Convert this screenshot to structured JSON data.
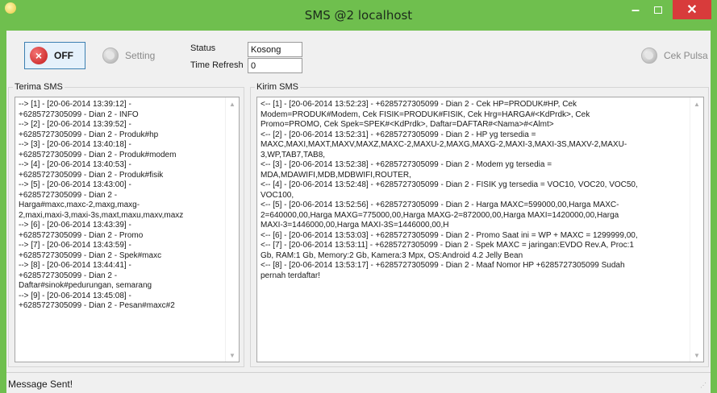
{
  "window": {
    "title": "SMS @2 localhost"
  },
  "toolbar": {
    "off_label": "OFF",
    "setting_label": "Setting",
    "cek_pulsa_label": "Cek Pulsa"
  },
  "fields": {
    "status_label": "Status",
    "status_value": "Kosong",
    "time_refresh_label": "Time Refresh",
    "time_refresh_value": "0"
  },
  "terima": {
    "title": "Terima SMS",
    "lines": [
      "--> [1] - [20-06-2014 13:39:12] -",
      "+6285727305099 - Dian 2 - INFO",
      "--> [2] - [20-06-2014 13:39:52] -",
      "+6285727305099 - Dian 2 - Produk#hp",
      "--> [3] - [20-06-2014 13:40:18] -",
      "+6285727305099 - Dian 2 - Produk#modem",
      "--> [4] - [20-06-2014 13:40:53] -",
      "+6285727305099 - Dian 2 - Produk#fisik",
      "--> [5] - [20-06-2014 13:43:00] -",
      "+6285727305099 - Dian 2 -",
      "Harga#maxc,maxc-2,maxg,maxg-",
      "2,maxi,maxi-3,maxi-3s,maxt,maxu,maxv,maxz",
      "--> [6] - [20-06-2014 13:43:39] -",
      "+6285727305099 - Dian 2 - Promo",
      "--> [7] - [20-06-2014 13:43:59] -",
      "+6285727305099 - Dian 2 - Spek#maxc",
      "--> [8] - [20-06-2014 13:44:41] -",
      "+6285727305099 - Dian 2 -",
      "Daftar#sinok#pedurungan, semarang",
      "--> [9] - [20-06-2014 13:45:08] -",
      "+6285727305099 - Dian 2 - Pesan#maxc#2"
    ]
  },
  "kirim": {
    "title": "Kirim SMS",
    "lines": [
      "<-- [1] - [20-06-2014 13:52:23] - +6285727305099 - Dian 2 - Cek HP=PRODUK#HP, Cek",
      "Modem=PRODUK#Modem, Cek FISIK=PRODUK#FISIK, Cek Hrg=HARGA#<KdPrdk>, Cek",
      "Promo=PROMO, Cek Spek=SPEK#<KdPrdk>, Daftar=DAFTAR#<Nama>#<Almt>",
      "<-- [2] - [20-06-2014 13:52:31] - +6285727305099 - Dian 2 - HP yg tersedia =",
      "MAXC,MAXI,MAXT,MAXV,MAXZ,MAXC-2,MAXU-2,MAXG,MAXG-2,MAXI-3,MAXI-3S,MAXV-2,MAXU-",
      "3,WP,TAB7,TAB8,",
      "<-- [3] - [20-06-2014 13:52:38] - +6285727305099 - Dian 2 - Modem yg tersedia =",
      "MDA,MDAWIFI,MDB,MDBWIFI,ROUTER,",
      "<-- [4] - [20-06-2014 13:52:48] - +6285727305099 - Dian 2 - FISIK yg tersedia = VOC10, VOC20, VOC50,",
      "VOC100,",
      "<-- [5] - [20-06-2014 13:52:56] - +6285727305099 - Dian 2 - Harga MAXC=599000,00,Harga MAXC-",
      "2=640000,00,Harga MAXG=775000,00,Harga MAXG-2=872000,00,Harga MAXI=1420000,00,Harga",
      "MAXI-3=1446000,00,Harga MAXI-3S=1446000,00,H",
      "<-- [6] - [20-06-2014 13:53:03] - +6285727305099 - Dian 2 - Promo Saat ini = WP + MAXC = 1299999,00,",
      "<-- [7] - [20-06-2014 13:53:11] - +6285727305099 - Dian 2 - Spek MAXC = jaringan:EVDO Rev.A, Proc:1",
      "Gb, RAM:1 Gb, Memory:2 Gb, Kamera:3 Mpx, OS:Android 4.2 Jelly Bean",
      "<-- [8] - [20-06-2014 13:53:17] - +6285727305099 - Dian 2 -  Maaf Nomor HP +6285727305099 Sudah",
      "pernah terdaftar!"
    ]
  },
  "statusbar": {
    "text": "Message Sent!"
  },
  "colors": {
    "title_bar": "#6fbf4e",
    "close_button": "#d83b3b",
    "off_icon": "#c2191a"
  }
}
